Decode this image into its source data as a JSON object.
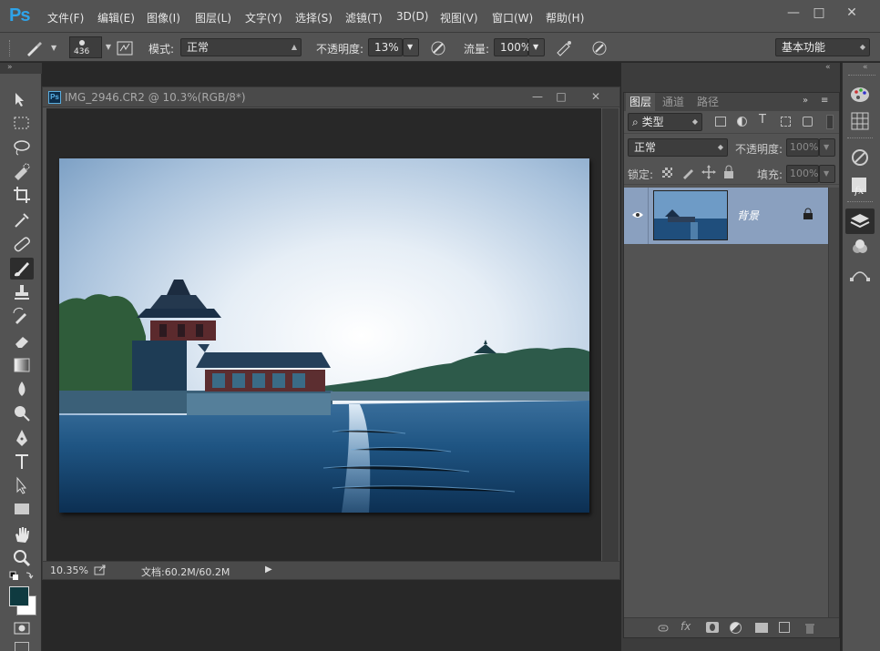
{
  "app": {
    "logo": "Ps"
  },
  "menu": [
    "文件(F)",
    "编辑(E)",
    "图像(I)",
    "图层(L)",
    "文字(Y)",
    "选择(S)",
    "滤镜(T)",
    "3D(D)",
    "视图(V)",
    "窗口(W)",
    "帮助(H)"
  ],
  "window_controls": {
    "minimize": "—",
    "maximize": "□",
    "close": "✕"
  },
  "options": {
    "brush_size": "436",
    "mode_label": "模式:",
    "mode_value": "正常",
    "opacity_label": "不透明度:",
    "opacity_value": "13%",
    "flow_label": "流量:",
    "flow_value": "100%",
    "workspace": "基本功能"
  },
  "document": {
    "title": "IMG_2946.CR2 @ 10.3%(RGB/8*)",
    "ps_badge": "Ps",
    "zoom": "10.35%",
    "doc_info": "文档:60.2M/60.2M"
  },
  "layers_panel": {
    "tabs": [
      "图层",
      "通道",
      "路径"
    ],
    "filter_label": "类型",
    "blend_mode": "正常",
    "opacity_label": "不透明度:",
    "opacity_value": "100%",
    "lock_label": "锁定:",
    "fill_label": "填充:",
    "fill_value": "100%",
    "layers": [
      {
        "name": "背景",
        "visible": true,
        "locked": true
      }
    ]
  },
  "colors": {
    "accent": "#2fa3e8",
    "selected_layer": "#8aa0bf",
    "foreground": "#0f3a40",
    "background": "#ffffff"
  }
}
